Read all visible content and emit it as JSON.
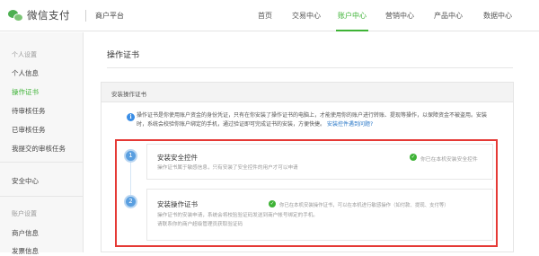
{
  "header": {
    "brand": "微信支付",
    "platform": "商户平台",
    "nav": [
      "首页",
      "交易中心",
      "账户中心",
      "营销中心",
      "产品中心",
      "数据中心"
    ],
    "active_nav": "账户中心"
  },
  "sidebar": {
    "group1": "个人设置",
    "items": [
      "个人信息",
      "操作证书",
      "待审核任务",
      "已审核任务",
      "我提交的审核任务"
    ],
    "active": "操作证书",
    "security": "安全中心",
    "group2": "账户设置",
    "items2": [
      "商户信息",
      "发票信息"
    ]
  },
  "main": {
    "title": "操作证书",
    "panel_title": "安装操作证书",
    "notice_icon": "i",
    "notice_text": "操作证书是你使用账户资金的身份凭证，只有在你安装了操作证书的电脑上，才能使用你的账户进行转账、提现等操作，以保障资金不被盗用。安装时，系统会校验你账户绑定的手机，通过验证即可完成证书的安装，方便快捷。",
    "notice_link": "安装控件遇到问题?",
    "steps": [
      {
        "number": "1",
        "title": "安装安全控件",
        "desc": "操作证书属于敏感信息，只有安装了安全控件的用户才可以申请",
        "status": "你已在本机安装安全控件"
      },
      {
        "number": "2",
        "title": "安装操作证书",
        "desc1": "操作证书的安装申请，系统会将校验验证码发送到商户帐号绑定的手机。",
        "desc2": "请联系你的商户超级管理员获取验证码",
        "status": "你已在本机安装操作证书，可以在本机进行敏感操作（如付款、提现、支付等）"
      }
    ]
  },
  "watermark": "〜"
}
